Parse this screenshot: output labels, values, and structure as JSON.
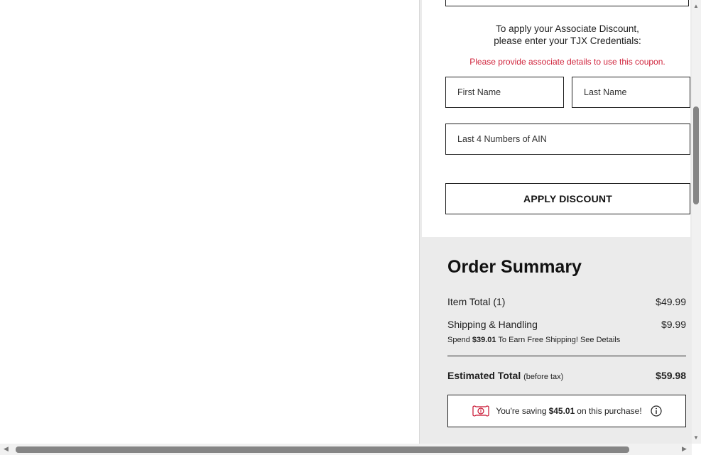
{
  "associate": {
    "instruction_line1": "To apply your Associate Discount,",
    "instruction_line2": "please enter your TJX Credentials:",
    "warning": "Please provide associate details to use this coupon.",
    "first_name_placeholder": "First Name",
    "last_name_placeholder": "Last Name",
    "ain_placeholder": "Last 4 Numbers of AIN",
    "apply_label": "APPLY DISCOUNT"
  },
  "summary": {
    "title": "Order Summary",
    "item_total_label": "Item Total (1)",
    "item_total_value": "$49.99",
    "shipping_label": "Shipping & Handling",
    "shipping_value": "$9.99",
    "promo_prefix": "Spend ",
    "promo_amount": "$39.01",
    "promo_suffix": " To Earn Free Shipping! See Details",
    "estimated_label": "Estimated Total",
    "estimated_note": "(before tax)",
    "estimated_value": "$59.98",
    "saving_prefix": "You're saving",
    "saving_amount": "$45.01",
    "saving_suffix": "on this purchase!"
  },
  "colors": {
    "warning": "#d0243c",
    "summary_bg": "#ebebeb",
    "money_icon": "#c8102e"
  },
  "icons": [
    "money-icon",
    "info-icon",
    "scroll-up-arrow-icon",
    "scroll-down-arrow-icon",
    "scroll-left-arrow-icon",
    "scroll-right-arrow-icon"
  ]
}
